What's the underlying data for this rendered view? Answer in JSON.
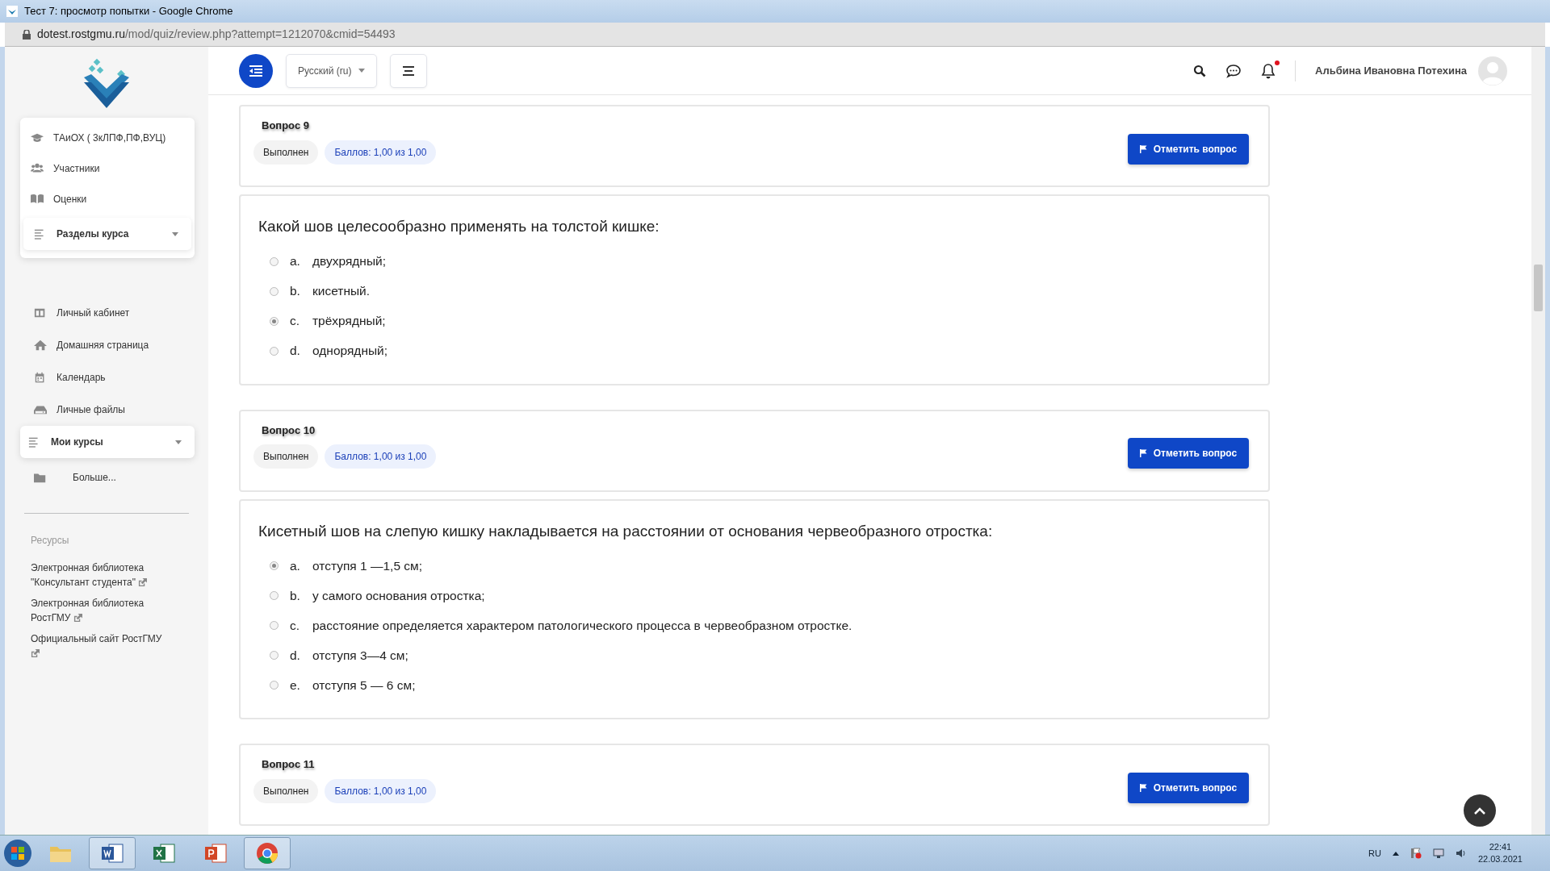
{
  "window": {
    "title": "Тест 7: просмотр попытки - Google Chrome"
  },
  "address_bar": {
    "host": "dotest.rostgmu.ru",
    "path": "/mod/quiz/review.php?attempt=1212070&cmid=54493"
  },
  "header": {
    "language": "Русский (ru)",
    "user_name": "Альбина Ивановна Потехина",
    "notification_unread": true
  },
  "sidebar": {
    "course_menu": [
      {
        "kind": "cap",
        "label": "ТАиОХ ( 3кЛПФ,ПФ,ВУЦ)"
      },
      {
        "kind": "users",
        "label": "Участники"
      },
      {
        "kind": "book",
        "label": "Оценки"
      },
      {
        "kind": "sections",
        "label": "Разделы курса"
      }
    ],
    "nav": [
      {
        "kind": "dashboard",
        "label": "Личный кабинет"
      },
      {
        "kind": "home",
        "label": "Домашняя страница"
      },
      {
        "kind": "calendar",
        "label": "Календарь"
      },
      {
        "kind": "drive",
        "label": "Личные файлы"
      },
      {
        "kind": "sections",
        "label": "Мои курсы"
      },
      {
        "kind": "folder",
        "label": "Больше..."
      }
    ],
    "resources_title": "Ресурсы",
    "resources": [
      "Электронная библиотека \"Консультант студента\"",
      "Электронная библиотека РостГМУ",
      "Официальный сайт РостГМУ"
    ]
  },
  "questions": [
    {
      "title": "Вопрос 9",
      "state": "Выполнен",
      "grade": "Баллов: 1,00 из 1,00",
      "flag_button": "Отметить вопрос",
      "prompt": "Какой шов целесообразно применять на толстой кишке:",
      "options": [
        {
          "letter": "a.",
          "text": "двухрядный;",
          "selected": false
        },
        {
          "letter": "b.",
          "text": "кисетный.",
          "selected": false
        },
        {
          "letter": "c.",
          "text": "трёхрядный;",
          "selected": true
        },
        {
          "letter": "d.",
          "text": "однорядный;",
          "selected": false
        }
      ]
    },
    {
      "title": "Вопрос 10",
      "state": "Выполнен",
      "grade": "Баллов: 1,00 из 1,00",
      "flag_button": "Отметить вопрос",
      "prompt": "Кисетный шов на слепую кишку накладывается на расстоянии от основания червеобразного отростка:",
      "options": [
        {
          "letter": "a.",
          "text": "отступя 1 —1,5 см;",
          "selected": true
        },
        {
          "letter": "b.",
          "text": "у самого основания отростка;",
          "selected": false
        },
        {
          "letter": "c.",
          "text": "расстояние определяется характером патологического процесса в червеобразном отростке.",
          "selected": false
        },
        {
          "letter": "d.",
          "text": "отступя 3—4 см;",
          "selected": false
        },
        {
          "letter": "e.",
          "text": "отступя 5 — 6 см;",
          "selected": false
        }
      ]
    },
    {
      "title": "Вопрос 11",
      "state": "Выполнен",
      "grade": "Баллов: 1,00 из 1,00",
      "flag_button": "Отметить вопрос"
    }
  ],
  "taskbar": {
    "apps": [
      {
        "kind": "explorer",
        "open": false
      },
      {
        "kind": "word",
        "open": true
      },
      {
        "kind": "excel",
        "open": false
      },
      {
        "kind": "powerpoint",
        "open": false
      },
      {
        "kind": "chrome",
        "open": true
      }
    ],
    "language": "RU",
    "time": "22:41",
    "date": "22.03.2021"
  }
}
